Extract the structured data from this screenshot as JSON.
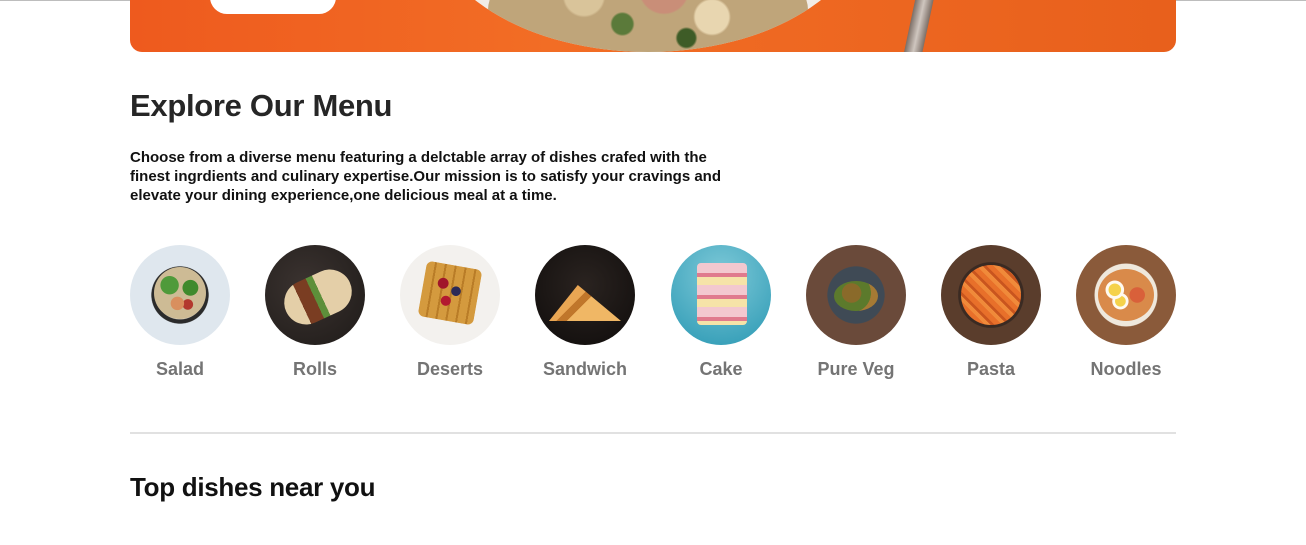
{
  "menu": {
    "title": "Explore Our Menu",
    "description": "Choose from a diverse menu featuring a delctable array of dishes crafed with the finest ingrdients and culinary expertise.Our mission is to satisfy your cravings and elevate your dining experience,one delicious meal at a time.",
    "categories": [
      {
        "label": "Salad",
        "icon": "salad-image"
      },
      {
        "label": "Rolls",
        "icon": "rolls-image"
      },
      {
        "label": "Deserts",
        "icon": "deserts-image"
      },
      {
        "label": "Sandwich",
        "icon": "sandwich-image"
      },
      {
        "label": "Cake",
        "icon": "cake-image"
      },
      {
        "label": "Pure Veg",
        "icon": "pure-veg-image"
      },
      {
        "label": "Pasta",
        "icon": "pasta-image"
      },
      {
        "label": "Noodles",
        "icon": "noodles-image"
      }
    ]
  },
  "top_dishes": {
    "title": "Top dishes near you"
  },
  "colors": {
    "hero_orange": "#f26d25",
    "heading": "#262626",
    "category_label": "#747474",
    "divider": "#e1e1e1"
  }
}
